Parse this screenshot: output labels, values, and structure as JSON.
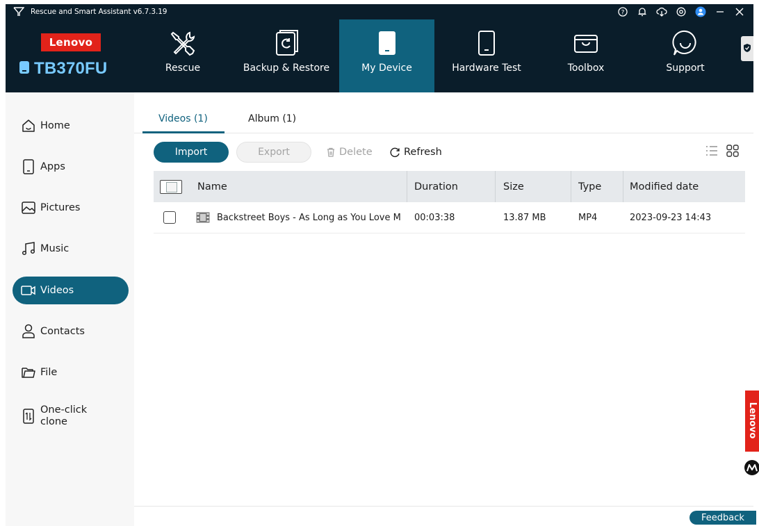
{
  "app": {
    "title": "Rescue and Smart Assistant v6.7.3.19"
  },
  "brand": {
    "logo_text": "Lenovo",
    "device_name": "TB370FU"
  },
  "nav": [
    {
      "label": "Rescue",
      "icon": "tools-icon"
    },
    {
      "label": "Backup & Restore",
      "icon": "backup-icon"
    },
    {
      "label": "My Device",
      "icon": "tablet-icon",
      "active": true
    },
    {
      "label": "Hardware Test",
      "icon": "device-outline-icon"
    },
    {
      "label": "Toolbox",
      "icon": "toolbox-icon"
    },
    {
      "label": "Support",
      "icon": "chat-icon"
    }
  ],
  "sidebar": {
    "items": [
      {
        "label": "Home",
        "icon": "home-icon"
      },
      {
        "label": "Apps",
        "icon": "phone-icon"
      },
      {
        "label": "Pictures",
        "icon": "picture-icon"
      },
      {
        "label": "Music",
        "icon": "music-icon"
      },
      {
        "label": "Videos",
        "icon": "video-icon",
        "active": true
      },
      {
        "label": "Contacts",
        "icon": "person-icon"
      },
      {
        "label": "File",
        "icon": "folder-icon"
      },
      {
        "label": "One-click clone",
        "line1": "One-click",
        "line2": "clone",
        "icon": "clone-icon"
      }
    ]
  },
  "tabs": [
    {
      "label": "Videos (1)",
      "active": true
    },
    {
      "label": "Album (1)"
    }
  ],
  "toolbar": {
    "import_label": "Import",
    "export_label": "Export",
    "delete_label": "Delete",
    "refresh_label": "Refresh"
  },
  "table": {
    "columns": [
      "Name",
      "Duration",
      "Size",
      "Type",
      "Modified date"
    ],
    "rows": [
      {
        "name": "Backstreet Boys - As Long as You Love M",
        "duration": "00:03:38",
        "size": "13.87 MB",
        "type": "MP4",
        "modified": "2023-09-23 14:43"
      }
    ]
  },
  "side_badges": {
    "lenovo_vertical": "Lenovo"
  },
  "feedback_label": "Feedback",
  "colors": {
    "accent": "#10627e",
    "header_bg": "#0a1d2a",
    "brand_red": "#e2231a",
    "device_blue": "#78caff"
  }
}
